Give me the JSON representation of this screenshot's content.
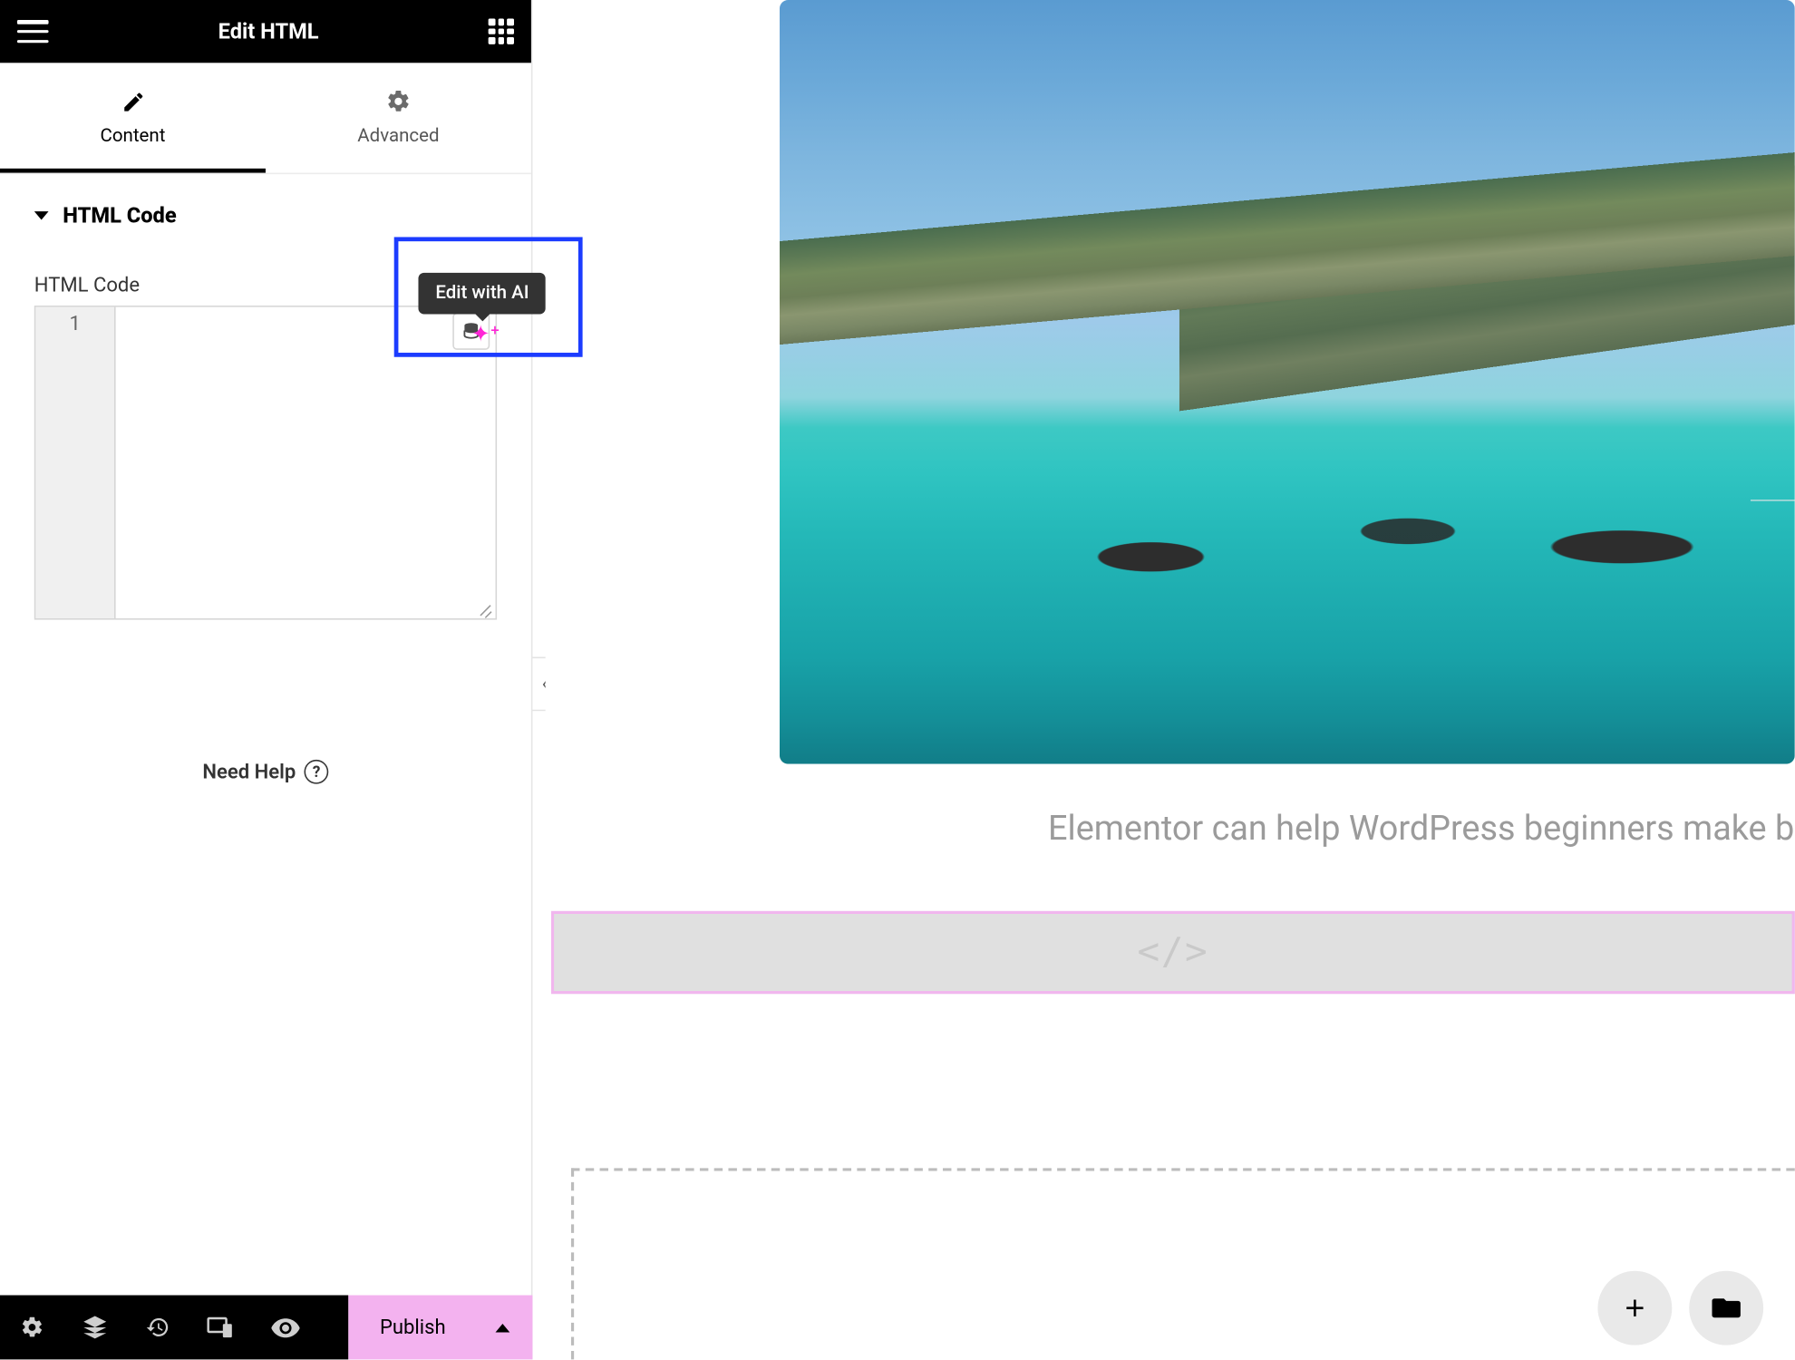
{
  "header": {
    "title": "Edit HTML"
  },
  "tabs": {
    "content": "Content",
    "advanced": "Advanced"
  },
  "section": {
    "title": "HTML Code"
  },
  "field": {
    "label": "HTML Code",
    "line_number": "1"
  },
  "ai": {
    "tooltip": "Edit with AI"
  },
  "help": {
    "label": "Need Help",
    "mark": "?"
  },
  "footer": {
    "publish": "Publish"
  },
  "preview": {
    "caption": "Elementor can help WordPress beginners make beautif"
  }
}
